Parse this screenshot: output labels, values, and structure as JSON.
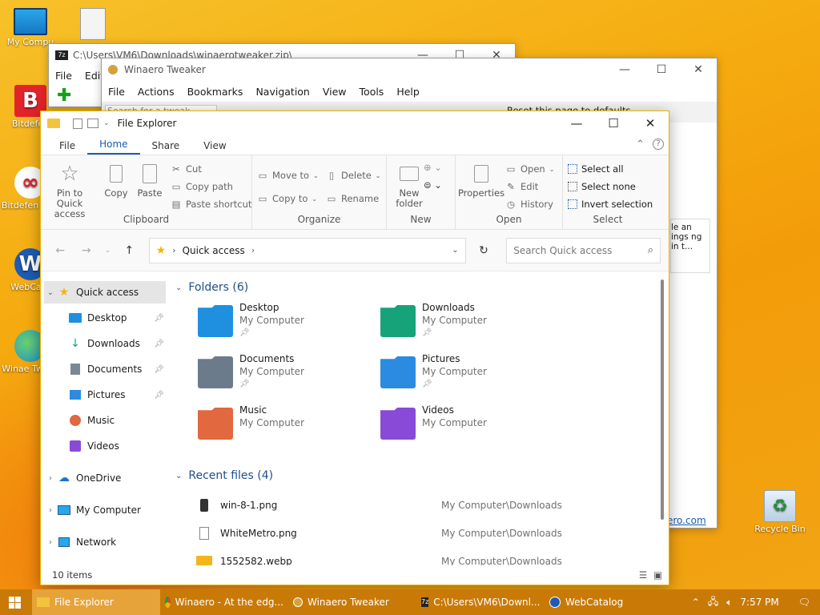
{
  "desktop": {
    "icons": [
      {
        "label": "My Compu"
      },
      {
        "label": "Bitdefen"
      },
      {
        "label": "Bitdefen VPN"
      },
      {
        "label": "WebCata"
      },
      {
        "label": "Winae Tweak"
      },
      {
        "label": "Recycle Bin"
      }
    ]
  },
  "zip_window": {
    "title": "C:\\Users\\VM6\\Downloads\\winaerotweaker.zip\\",
    "menu": [
      "File",
      "Edit"
    ]
  },
  "tweaker_window": {
    "title": "Winaero Tweaker",
    "menu": [
      "File",
      "Actions",
      "Bookmarks",
      "Navigation",
      "View",
      "Tools",
      "Help"
    ],
    "reset_label": "Reset this page to defaults",
    "search_placeholder": "Search for a tweak...",
    "side_text": "le an ings ng in t...",
    "link_text": "ero.com"
  },
  "explorer": {
    "title": "File Explorer",
    "tabs": [
      "File",
      "Home",
      "Share",
      "View"
    ],
    "active_tab": "Home",
    "ribbon": {
      "clipboard": {
        "pin": "Pin to Quick access",
        "copy": "Copy",
        "paste": "Paste",
        "cut": "Cut",
        "copy_path": "Copy path",
        "paste_shortcut": "Paste shortcut",
        "name": "Clipboard"
      },
      "organize": {
        "move_to": "Move to",
        "copy_to": "Copy to",
        "delete": "Delete",
        "rename": "Rename",
        "name": "Organize"
      },
      "new": {
        "new_folder": "New folder",
        "name": "New"
      },
      "open": {
        "properties": "Properties",
        "open": "Open",
        "edit": "Edit",
        "history": "History",
        "name": "Open"
      },
      "select": {
        "select_all": "Select all",
        "select_none": "Select none",
        "invert": "Invert selection",
        "name": "Select"
      }
    },
    "address": {
      "location": "Quick access",
      "search_placeholder": "Search Quick access"
    },
    "nav": [
      {
        "label": "Quick access",
        "expanded": true,
        "selected": true
      },
      {
        "label": "Desktop",
        "pinned": true
      },
      {
        "label": "Downloads",
        "pinned": true
      },
      {
        "label": "Documents",
        "pinned": true
      },
      {
        "label": "Pictures",
        "pinned": true
      },
      {
        "label": "Music"
      },
      {
        "label": "Videos"
      },
      {
        "label": "OneDrive"
      },
      {
        "label": "My Computer"
      },
      {
        "label": "Network"
      }
    ],
    "folders_header": "Folders (6)",
    "folders": [
      {
        "name": "Desktop",
        "location": "My Computer",
        "pinned": true,
        "color": "#1f8fe0"
      },
      {
        "name": "Downloads",
        "location": "My Computer",
        "pinned": true,
        "color": "#17a37a"
      },
      {
        "name": "Documents",
        "location": "My Computer",
        "pinned": true,
        "color": "#6c7b8c"
      },
      {
        "name": "Pictures",
        "location": "My Computer",
        "pinned": true,
        "color": "#2b8be0"
      },
      {
        "name": "Music",
        "location": "My Computer",
        "pinned": false,
        "color": "#e1683f"
      },
      {
        "name": "Videos",
        "location": "My Computer",
        "pinned": false,
        "color": "#8a4ad8"
      }
    ],
    "recent_header": "Recent files (4)",
    "recent": [
      {
        "name": "win-8-1.png",
        "path": "My Computer\\Downloads"
      },
      {
        "name": "WhiteMetro.png",
        "path": "My Computer\\Downloads"
      },
      {
        "name": "1552582.webp",
        "path": "My Computer\\Downloads"
      }
    ],
    "status": "10 items"
  },
  "taskbar": {
    "buttons": [
      {
        "label": "File Explorer",
        "active": true
      },
      {
        "label": "Winaero - At the edg..."
      },
      {
        "label": "Winaero Tweaker"
      },
      {
        "label": "C:\\Users\\VM6\\Downl..."
      },
      {
        "label": "WebCatalog"
      }
    ],
    "clock": "7:57 PM"
  }
}
